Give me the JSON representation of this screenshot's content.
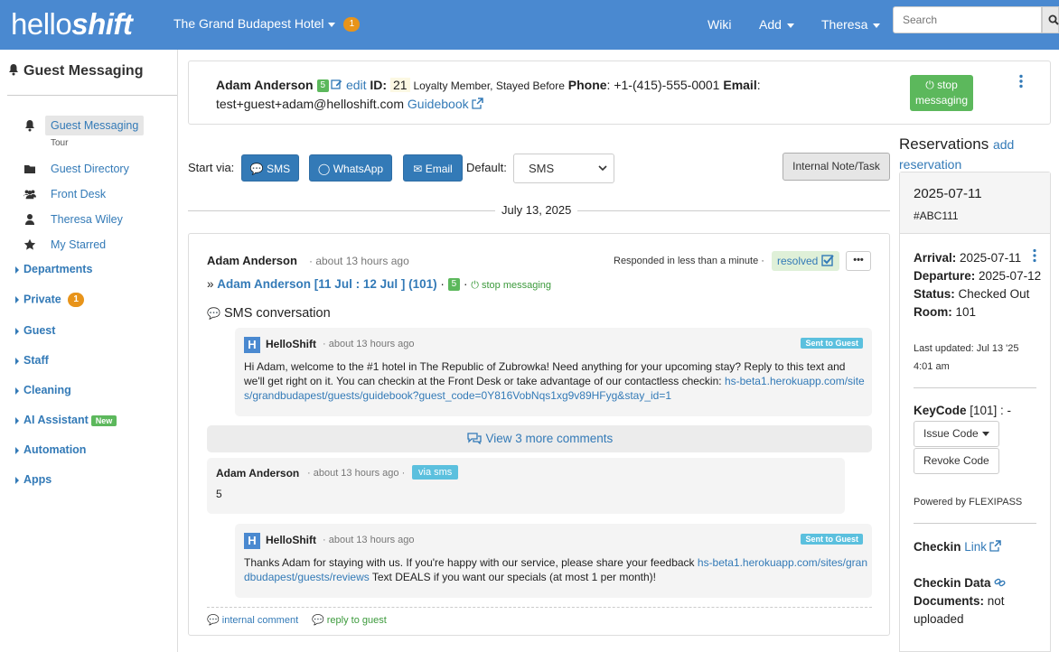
{
  "nav": {
    "logo_light": "hello",
    "logo_bold": "shift",
    "hotel": "The Grand Budapest Hotel",
    "hotel_badge": "1",
    "wiki": "Wiki",
    "add": "Add",
    "user": "Theresa",
    "search_placeholder": "Search"
  },
  "sidebar": {
    "title": "Guest Messaging",
    "items": [
      {
        "label": "Guest Messaging",
        "icon": "bell-icon"
      },
      {
        "label": "Guest Directory",
        "icon": "folder-icon"
      },
      {
        "label": "Front Desk",
        "icon": "users-icon"
      },
      {
        "label": "Theresa Wiley",
        "icon": "user-icon"
      },
      {
        "label": "My Starred",
        "icon": "star-icon"
      }
    ],
    "tour": "Tour",
    "sections": [
      {
        "label": "Departments"
      },
      {
        "label": "Private",
        "badge": "1"
      },
      {
        "label": "Guest"
      },
      {
        "label": "Staff"
      },
      {
        "label": "Cleaning"
      },
      {
        "label": "AI Assistant",
        "badge": "New"
      },
      {
        "label": "Automation"
      },
      {
        "label": "Apps"
      }
    ]
  },
  "guest": {
    "name": "Adam Anderson",
    "score": "5",
    "edit": "edit",
    "id_label": "ID:",
    "id": "21",
    "status": "Loyalty Member, Stayed Before",
    "phone_label": "Phone",
    "phone": ": +1-(415)-555-0001",
    "email_label": "Email",
    "email_sep": ":",
    "email": "test+guest+adam@helloshift.com",
    "guidebook": "Guidebook",
    "stop_line1": "stop",
    "stop_line2": "messaging"
  },
  "compose": {
    "start_via": "Start via:",
    "sms": "SMS",
    "whatsapp": "WhatsApp",
    "email": "Email",
    "default_label": "Default:",
    "default_value": "SMS",
    "internal_note": "Internal Note/Task"
  },
  "date_divider": "July 13, 2025",
  "thread": {
    "name": "Adam Anderson",
    "time": "· about 13 hours ago",
    "responded": "Responded in less than a minute ·",
    "resolved": "resolved",
    "more": "•••",
    "stay_prefix": "»",
    "stay": "Adam Anderson [11 Jul : 12 Jul ] (101)",
    "stay_sep": "·",
    "stay_score": "5",
    "stop": "stop messaging",
    "conversation": "SMS conversation",
    "msg1": {
      "who": "HelloShift",
      "time": "· about 13 hours ago",
      "tag": "Sent to Guest",
      "text": "Hi Adam, welcome to the #1 hotel in The Republic of Zubrowka! Need anything for your upcoming stay? Reply to this text and we'll get right on it. You can checkin at the Front Desk or take advantage of our contactless checkin:",
      "link": "hs-beta1.herokuapp.com/sites/grandbudapest/guests/guidebook?guest_code=0Y816VobNqs1xg9v89HFyg&stay_id=1"
    },
    "view_more": "View 3 more comments",
    "reply": {
      "who": "Adam Anderson",
      "time": "· about 13 hours ago ·",
      "via": "via sms",
      "text": "5"
    },
    "msg2": {
      "who": "HelloShift",
      "time": "· about 13 hours ago",
      "tag": "Sent to Guest",
      "text_before": "Thanks Adam for staying with us. If you're happy with our service, please share your feedback",
      "link": "hs-beta1.herokuapp.com/sites/grandbudapest/guests/reviews",
      "text_after": "Text DEALS if you want our specials (at most 1 per month)!"
    },
    "internal_comment": "internal comment",
    "reply_to_guest": "reply to guest"
  },
  "reservations": {
    "title": "Reservations",
    "add": "add reservation",
    "date": "2025-07-11",
    "code": "#ABC111",
    "arrival_label": "Arrival:",
    "arrival": "2025-07-11",
    "departure_label": "Departure:",
    "departure": "2025-07-12",
    "status_label": "Status:",
    "status": "Checked Out",
    "room_label": "Room:",
    "room": "101",
    "updated": "Last updated: Jul 13 '25 4:01 am",
    "keycode_label": "KeyCode",
    "keycode": "[101] : -",
    "issue_code": "Issue Code",
    "revoke_code": "Revoke Code",
    "powered": "Powered by FLEXIPASS",
    "checkin_label": "Checkin",
    "checkin_link": "Link",
    "checkin_data": "Checkin Data",
    "documents_label": "Documents:",
    "documents": "not uploaded"
  }
}
